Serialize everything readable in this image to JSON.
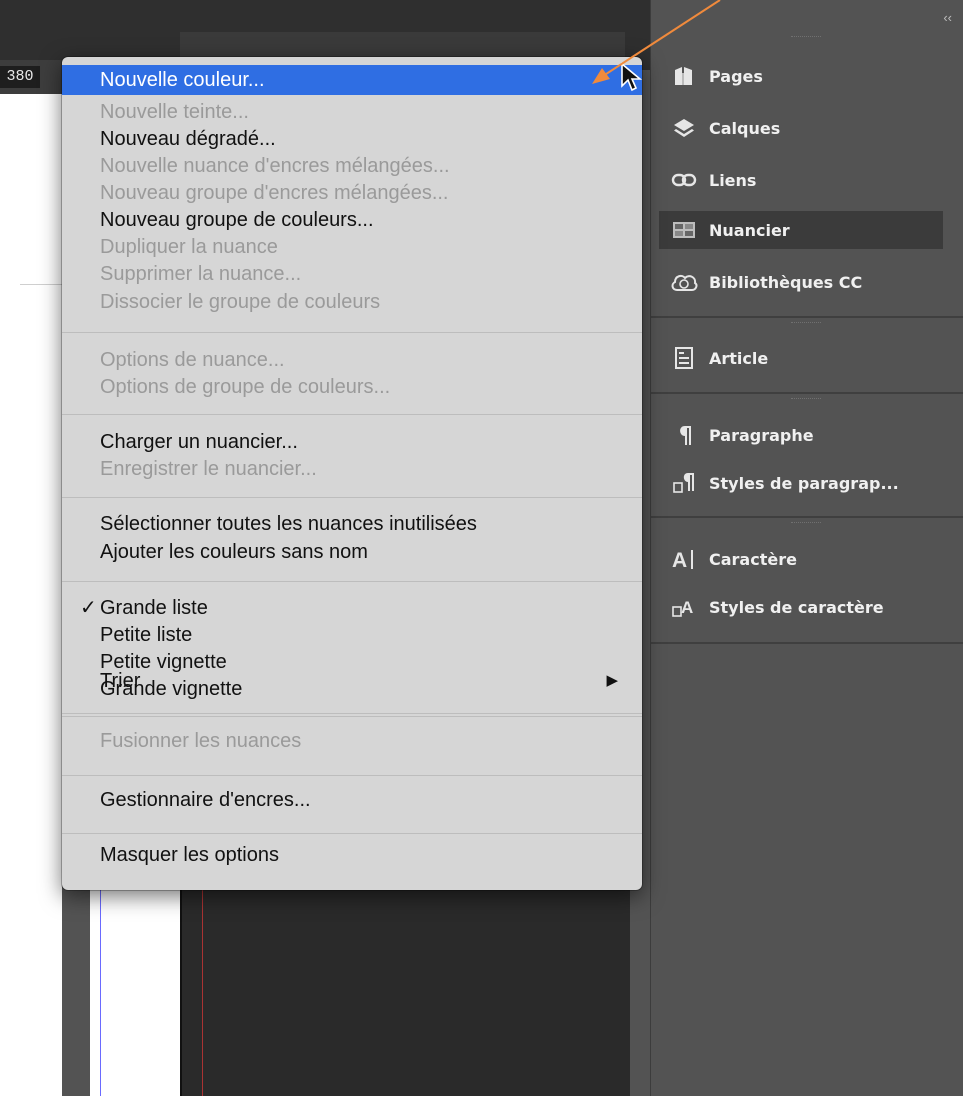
{
  "ruler": {
    "value": "380"
  },
  "menu": {
    "items": [
      {
        "label": "Nouvelle couleur...",
        "state": "highlighted"
      },
      {
        "label": "Nouvelle teinte...",
        "state": "disabled"
      },
      {
        "label": "Nouveau dégradé...",
        "state": "enabled"
      },
      {
        "label": "Nouvelle nuance d'encres mélangées...",
        "state": "disabled"
      },
      {
        "label": "Nouveau groupe d'encres mélangées...",
        "state": "disabled"
      },
      {
        "label": "Nouveau groupe de couleurs...",
        "state": "enabled"
      },
      {
        "label": "Dupliquer la nuance",
        "state": "disabled"
      },
      {
        "label": "Supprimer la nuance...",
        "state": "disabled"
      },
      {
        "label": "Dissocier le groupe de couleurs",
        "state": "disabled"
      },
      {
        "label": "Options de nuance...",
        "state": "disabled"
      },
      {
        "label": "Options de groupe de couleurs...",
        "state": "disabled"
      },
      {
        "label": "Charger un nuancier...",
        "state": "enabled"
      },
      {
        "label": "Enregistrer le nuancier...",
        "state": "disabled"
      },
      {
        "label": "Sélectionner toutes les nuances inutilisées",
        "state": "enabled"
      },
      {
        "label": "Ajouter les couleurs sans nom",
        "state": "enabled"
      },
      {
        "label": "Grande liste",
        "state": "enabled",
        "checked": true
      },
      {
        "label": "Petite liste",
        "state": "enabled"
      },
      {
        "label": "Petite vignette",
        "state": "enabled"
      },
      {
        "label": "Grande vignette",
        "state": "enabled"
      },
      {
        "label": "Trier",
        "state": "enabled",
        "submenu": true
      },
      {
        "label": "Fusionner les nuances",
        "state": "disabled"
      },
      {
        "label": "Gestionnaire d'encres...",
        "state": "enabled"
      },
      {
        "label": "Masquer les options",
        "state": "enabled"
      }
    ],
    "check_glyph": "✓",
    "submenu_glyph": "▶"
  },
  "panel": {
    "collapse_label": "‹‹",
    "items": [
      {
        "label": "Pages",
        "icon": "pages-icon"
      },
      {
        "label": "Calques",
        "icon": "layers-icon"
      },
      {
        "label": "Liens",
        "icon": "links-icon"
      },
      {
        "label": "Nuancier",
        "icon": "swatches-icon",
        "active": true
      },
      {
        "label": "Bibliothèques CC",
        "icon": "cc-libraries-icon"
      },
      {
        "label": "Article",
        "icon": "article-icon"
      },
      {
        "label": "Paragraphe",
        "icon": "paragraph-icon"
      },
      {
        "label": "Styles de paragrap...",
        "icon": "paragraph-styles-icon"
      },
      {
        "label": "Caractère",
        "icon": "character-icon"
      },
      {
        "label": "Styles de caractère",
        "icon": "character-styles-icon"
      }
    ]
  },
  "colors": {
    "highlight": "#2f6ee3",
    "annotation_arrow": "#f08a3c",
    "panel_bg": "#535353",
    "menu_bg": "#d6d6d6"
  }
}
